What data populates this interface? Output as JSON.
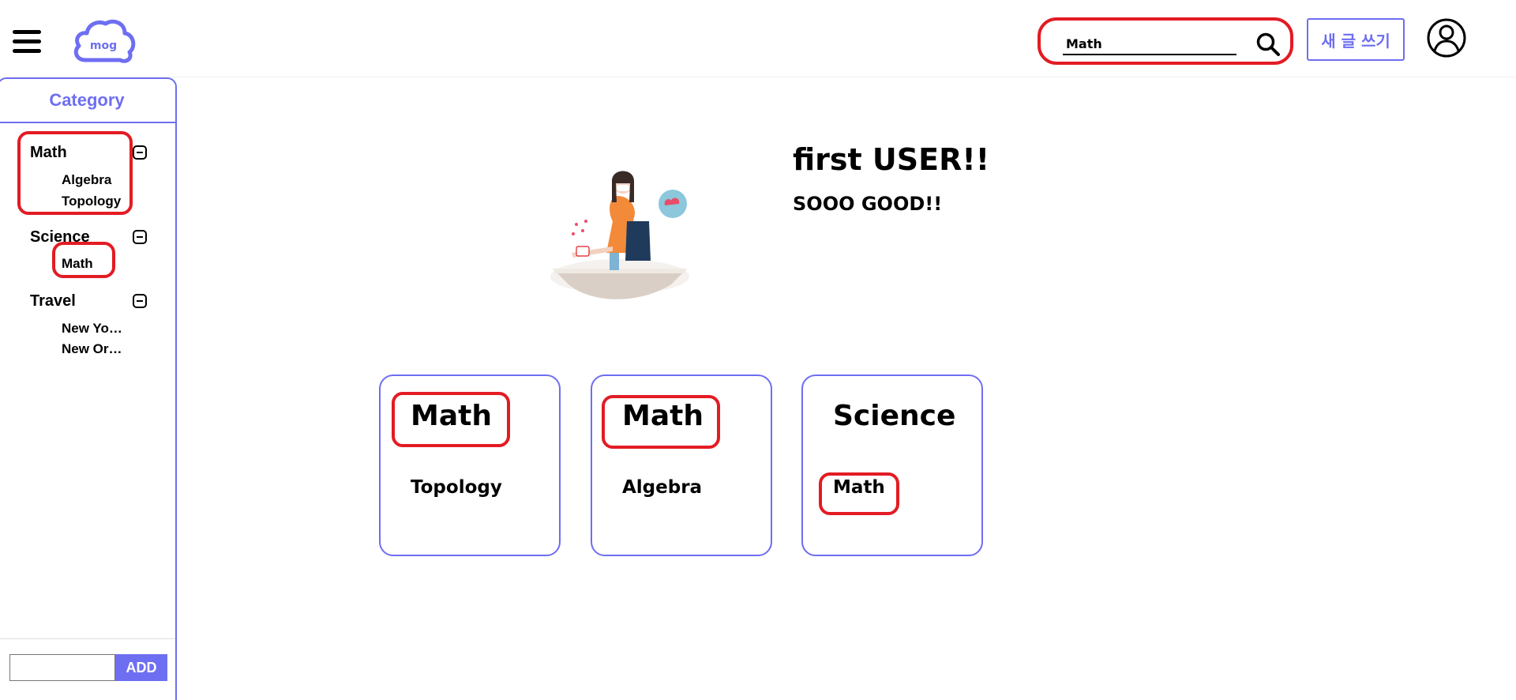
{
  "header": {
    "search": {
      "value": "Math",
      "placeholder": ""
    },
    "write_label": "새 글 쓰기",
    "logo_text": "mog"
  },
  "sidebar": {
    "title": "Category",
    "categories": [
      {
        "label": "Math",
        "children": [
          "Algebra",
          "Topology"
        ]
      },
      {
        "label": "Science",
        "children": [
          "Math"
        ]
      },
      {
        "label": "Travel",
        "children": [
          "New Yo…",
          "New Or…"
        ]
      }
    ],
    "add_label": "ADD"
  },
  "profile": {
    "name": "first USER!!",
    "description": "SOOO GOOD!!"
  },
  "cards": [
    {
      "title": "Math",
      "subtitle": "Topology"
    },
    {
      "title": "Math",
      "subtitle": "Algebra"
    },
    {
      "title": "Science",
      "subtitle": "Math"
    }
  ],
  "colors": {
    "accent": "#6e6ef2",
    "highlight": "#e31b23"
  }
}
